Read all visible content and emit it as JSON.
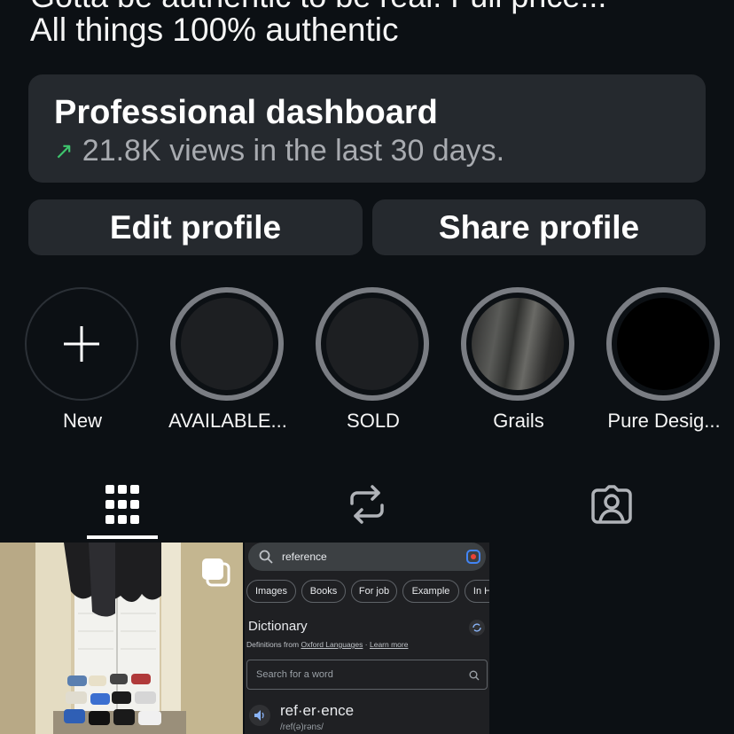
{
  "bio": {
    "partial_line": "Gotta be authentic to be real. Full price...",
    "line": "All things 100% authentic"
  },
  "dashboard": {
    "title": "Professional dashboard",
    "subtitle": "21.8K views in the last 30 days.",
    "trend_icon": "arrow-up-right-icon",
    "trend_color": "#3ec46d"
  },
  "actions": {
    "edit": "Edit profile",
    "share": "Share profile"
  },
  "highlights": [
    {
      "label": "New"
    },
    {
      "label": "AVAILABLE..."
    },
    {
      "label": "SOLD"
    },
    {
      "label": "Grails"
    },
    {
      "label": "Pure Desig..."
    }
  ],
  "tabs": [
    {
      "name": "posts",
      "icon": "grid-icon",
      "active": true
    },
    {
      "name": "reposts",
      "icon": "repost-icon",
      "active": false
    },
    {
      "name": "tagged",
      "icon": "tagged-person-icon",
      "active": false
    }
  ],
  "posts": {
    "second": {
      "search_query": "reference",
      "chips": [
        "Images",
        "Books",
        "For job",
        "Example",
        "In H"
      ],
      "dictionary_title": "Dictionary",
      "definitions_prefix": "Definitions from",
      "definitions_source": "Oxford Languages",
      "definitions_sep": "·",
      "learn_more": "Learn more",
      "search_placeholder": "Search for a word",
      "word": "ref·er·ence",
      "phonetic": "/ref(ə)rəns/"
    }
  },
  "colors": {
    "background": "#0c1014",
    "card": "#25292e",
    "ring": "#7a7d83"
  }
}
